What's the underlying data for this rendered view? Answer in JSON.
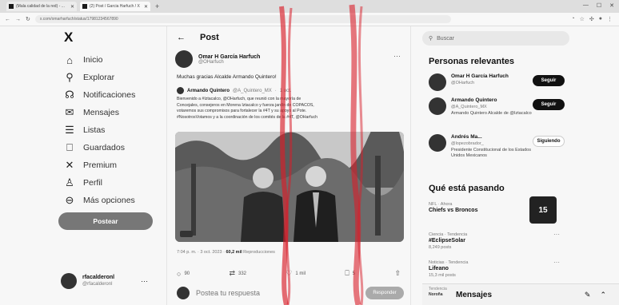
{
  "browser": {
    "tabs": [
      {
        "title": "(Mala calidad de la red) - ...",
        "active": false
      },
      {
        "title": "(2) Post / Garcia Harfuch / X",
        "active": true
      }
    ],
    "url": "x.com/omarharfuch/status/17981234567890"
  },
  "sidebar": {
    "logo": "X",
    "items": [
      {
        "label": "Inicio",
        "icon": "home-icon",
        "glyph": "⌂"
      },
      {
        "label": "Explorar",
        "icon": "search-icon",
        "glyph": "⚲"
      },
      {
        "label": "Notificaciones",
        "icon": "bell-icon",
        "glyph": "☊"
      },
      {
        "label": "Mensajes",
        "icon": "mail-icon",
        "glyph": "✉"
      },
      {
        "label": "Listas",
        "icon": "list-icon",
        "glyph": "☰"
      },
      {
        "label": "Guardados",
        "icon": "bookmark-icon",
        "glyph": "⎕"
      },
      {
        "label": "Premium",
        "icon": "x-logo-icon",
        "glyph": "✕"
      },
      {
        "label": "Perfil",
        "icon": "person-icon",
        "glyph": "♙"
      },
      {
        "label": "Más opciones",
        "icon": "more-circle-icon",
        "glyph": "⊖"
      }
    ],
    "post_button": "Postear",
    "account": {
      "name": "rfacalderonl",
      "handle": "@rfacalderonl"
    }
  },
  "post": {
    "header": "Post",
    "author": {
      "name": "Omar H García Harfuch",
      "handle": "@OHarfuch"
    },
    "text": "Muchas gracias Alcalde Armando Quintero!",
    "quote": {
      "name": "Armando Quintero",
      "handle": "@A_Quintero_MX",
      "time": "1 oct.",
      "lines": [
        "Bienvenido a #Iztacalco, @OHarfuch, que reunió con la mayoría de",
        "Concejales, consejeros en Morena Iztacalco y fuerza jardín de COPACOS,",
        "votaremos sus compromisos para fortalecer la #4T y su apoyo al Pote.",
        "#NosotrosVotamos y a la coordinación de los comités de la #4T, @OHarfuch"
      ]
    },
    "meta": {
      "time": "7:04 p. m. · 3 oct. 2023 · ",
      "views": "60,2 mil",
      "views_label": " Reproducciones"
    },
    "actions": {
      "replies": "90",
      "reposts": "332",
      "likes": "1 mil",
      "bookmarks": "5"
    },
    "reply_placeholder": "Postea tu respuesta",
    "reply_button": "Responder"
  },
  "right": {
    "search_placeholder": "Buscar",
    "relevant_title": "Personas relevantes",
    "people": [
      {
        "name": "Omar H García Harfuch",
        "handle": "@OHarfuch",
        "bio": "",
        "button": "Seguir"
      },
      {
        "name": "Armando Quintero",
        "handle": "@A_Quintero_MX",
        "bio": "Armando Quintero Alcalde de @Iztacalco",
        "button": "Seguir"
      },
      {
        "name": "Andrés Ma...",
        "handle": "@lopezobrador_",
        "bio": "Presidente Constitucional de los Estados Unidos Mexicanos",
        "button": "Siguiendo"
      }
    ],
    "trends_title": "Qué está pasando",
    "trends": [
      {
        "category": "NFL · Ahora",
        "name": "Chiefs vs Broncos",
        "count": ""
      },
      {
        "category": "Ciencia · Tendencia",
        "name": "#EclipseSolar",
        "count": "8,249 posts"
      },
      {
        "category": "Noticias · Tendencia",
        "name": "Lifeano",
        "count": "15,3 mil posts"
      },
      {
        "category": "Tendencia",
        "name": "Noroña",
        "count": ""
      }
    ],
    "trend_image_label": "15",
    "messages_title": "Mensajes"
  }
}
